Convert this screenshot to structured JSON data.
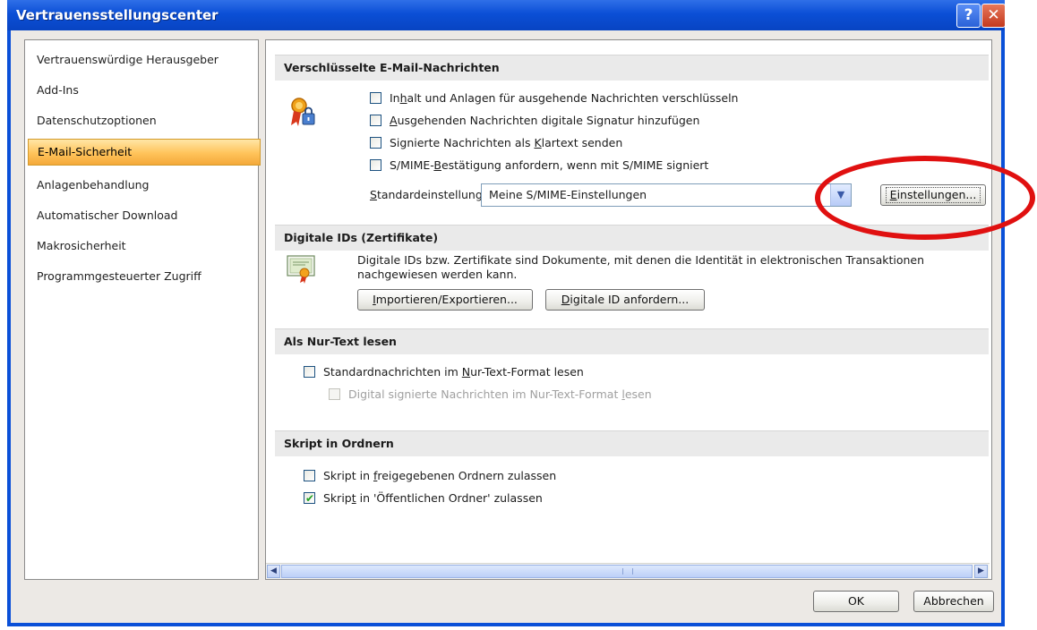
{
  "window": {
    "title": "Vertrauensstellungscenter",
    "help_glyph": "?",
    "close_glyph": "✕"
  },
  "sidebar": {
    "items": [
      {
        "label": "Vertrauenswürdige Herausgeber",
        "selected": false
      },
      {
        "label": "Add-Ins",
        "selected": false
      },
      {
        "label": "Datenschutzoptionen",
        "selected": false
      },
      {
        "label": "E-Mail-Sicherheit",
        "selected": true
      },
      {
        "label": "Anlagenbehandlung",
        "selected": false
      },
      {
        "label": "Automatischer Download",
        "selected": false
      },
      {
        "label": "Makrosicherheit",
        "selected": false
      },
      {
        "label": "Programmgesteuerter Zugriff",
        "selected": false
      }
    ]
  },
  "encrypted": {
    "header": "Verschlüsselte E-Mail-Nachrichten",
    "options": [
      {
        "pre": "In",
        "acc": "h",
        "post": "alt und Anlagen für ausgehende Nachrichten verschlüsseln",
        "checked": false
      },
      {
        "pre": "",
        "acc": "A",
        "post": "usgehenden Nachrichten digitale Signatur hinzufügen",
        "checked": false
      },
      {
        "pre": "Signierte Nachrichten als ",
        "acc": "K",
        "post": "lartext senden",
        "checked": false
      },
      {
        "pre": "S/MIME-",
        "acc": "B",
        "post": "estätigung anfordern, wenn mit S/MIME signiert",
        "checked": false
      }
    ],
    "default_label_acc": "S",
    "default_label_rest": "tandardeinstellung:",
    "default_value": "Meine S/MIME-Einstellungen",
    "settings_btn_acc": "E",
    "settings_btn_rest": "instellungen..."
  },
  "digital_ids": {
    "header": "Digitale IDs (Zertifikate)",
    "description": "Digitale IDs bzw. Zertifikate sind Dokumente, mit denen die Identität in elektronischen Transaktionen nachgewiesen werden kann.",
    "import_btn_acc": "I",
    "import_btn_rest": "mportieren/Exportieren...",
    "request_btn_acc": "D",
    "request_btn_rest": "igitale ID anfordern..."
  },
  "plaintext": {
    "header": "Als Nur-Text lesen",
    "opt1_pre": "Standardnachrichten im ",
    "opt1_acc": "N",
    "opt1_post": "ur-Text-Format lesen",
    "opt1_checked": false,
    "opt2_pre": "Digital signierte Nachrichten im Nur-Text-Format ",
    "opt2_acc": "l",
    "opt2_post": "esen",
    "opt2_checked": false
  },
  "script": {
    "header": "Skript in Ordnern",
    "opt1_pre": "Skript in ",
    "opt1_acc": "f",
    "opt1_post": "reigegebenen Ordnern zulassen",
    "opt1_checked": false,
    "opt2_pre": "Skrip",
    "opt2_acc": "t",
    "opt2_post": " in 'Öffentlichen Ordner' zulassen",
    "opt2_checked": true
  },
  "footer": {
    "ok_label": "OK",
    "cancel_label": "Abbrechen"
  },
  "colors": {
    "title_bar": "#0b4fd6",
    "selection": "#ffc35a",
    "highlight_ellipse": "#e01010"
  }
}
